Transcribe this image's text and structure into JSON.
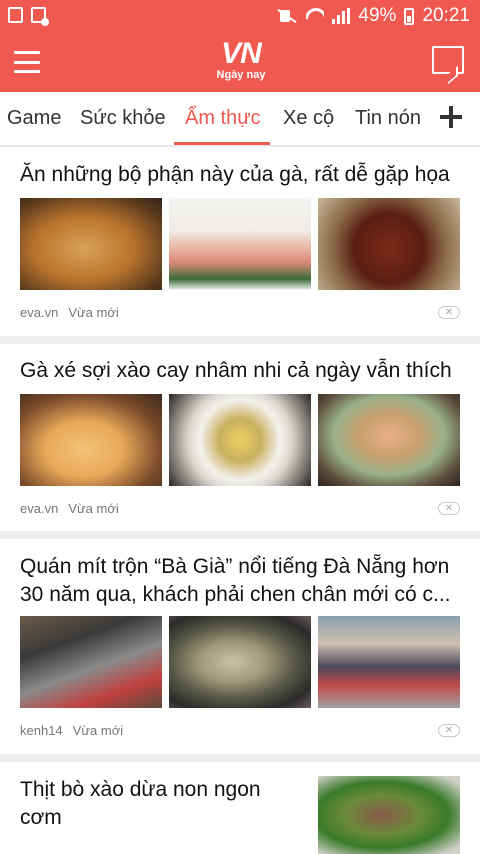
{
  "status_bar": {
    "battery": "49%",
    "time": "20:21"
  },
  "header": {
    "logo_main": "VN",
    "logo_sub": "Ngày nay"
  },
  "tabs": [
    {
      "label": "Game",
      "active": false
    },
    {
      "label": "Sức khỏe",
      "active": false
    },
    {
      "label": "Ẩm thực",
      "active": true
    },
    {
      "label": "Xe cộ",
      "active": false
    },
    {
      "label": "Tin nón",
      "active": false
    }
  ],
  "articles": [
    {
      "title": "Ăn những bộ phận này của gà, rất dễ gặp họa",
      "source": "eva.vn",
      "time": "Vừa mới"
    },
    {
      "title": "Gà xé sợi xào cay nhâm nhi cả ngày vẫn thích",
      "source": "eva.vn",
      "time": "Vừa mới"
    },
    {
      "title": "Quán mít trộn “Bà Già” nổi tiếng Đà Nẵng hơn 30 năm qua, khách phải chen chân mới có c...",
      "source": "kenh14",
      "time": "Vừa mới"
    },
    {
      "title": "Thịt bò xào dừa non ngon cơm"
    }
  ],
  "close_glyph": "✕",
  "icons": {
    "status": [
      "image-icon",
      "document-icon",
      "mute-icon",
      "wifi-icon",
      "signal-icon",
      "battery-icon"
    ],
    "header": [
      "menu-icon",
      "chat-icon"
    ],
    "tabs": [
      "add-icon"
    ]
  },
  "colors": {
    "accent": "#f0594f",
    "text": "#111111",
    "meta": "#777777"
  }
}
